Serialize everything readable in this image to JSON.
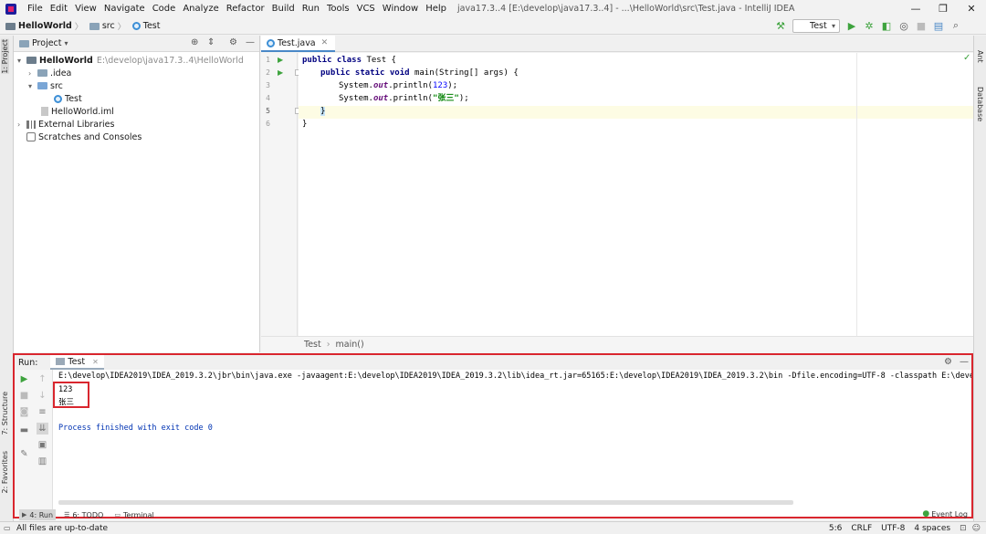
{
  "window": {
    "title": "java17.3..4 [E:\\develop\\java17.3..4] - ...\\HelloWorld\\src\\Test.java - IntelliJ IDEA",
    "minimize": "—",
    "restore": "❐",
    "close": "✕"
  },
  "menu": [
    "File",
    "Edit",
    "View",
    "Navigate",
    "Code",
    "Analyze",
    "Refactor",
    "Build",
    "Run",
    "Tools",
    "VCS",
    "Window",
    "Help"
  ],
  "breadcrumb": {
    "project": "HelloWorld",
    "folder": "src",
    "file": "Test"
  },
  "toolbar": {
    "run_config": "Test"
  },
  "left_strip": {
    "project_tab": "1: Project",
    "structure_tab": "7: Structure",
    "favorites_tab": "2: Favorites"
  },
  "right_strip": {
    "ant_tab": "Ant",
    "database_tab": "Database"
  },
  "project_panel": {
    "title": "Project",
    "tree": {
      "root_name": "HelloWorld",
      "root_path": "E:\\develop\\java17.3..4\\HelloWorld",
      "idea": ".idea",
      "src": "src",
      "test": "Test",
      "iml": "HelloWorld.iml",
      "libraries": "External Libraries",
      "scratches": "Scratches and Consoles"
    }
  },
  "editor": {
    "tab_label": "Test.java",
    "line_numbers": [
      "1",
      "2",
      "3",
      "4",
      "5",
      "6"
    ],
    "code": {
      "l1_kw": "public class",
      "l1_rest": " Test {",
      "l2_kw": "public static void",
      "l2_rest": " main(String[] args) {",
      "l3_a": "System.",
      "l3_field": "out",
      "l3_b": ".println(",
      "l3_num": "123",
      "l3_c": ");",
      "l4_a": "System.",
      "l4_field": "out",
      "l4_b": ".println(",
      "l4_str": "\"张三\"",
      "l4_c": ");",
      "l5": "}",
      "l6": "}"
    },
    "context_breadcrumb": {
      "class": "Test",
      "method": "main()"
    }
  },
  "run_panel": {
    "title": "Run:",
    "tab": "Test",
    "console": {
      "command": "E:\\develop\\IDEA2019\\IDEA_2019.3.2\\jbr\\bin\\java.exe -javaagent:E:\\develop\\IDEA2019\\IDEA_2019.3.2\\lib\\idea_rt.jar=65165:E:\\develop\\IDEA2019\\IDEA_2019.3.2\\bin -Dfile.encoding=UTF-8 -classpath E:\\develo",
      "output1": "123",
      "output2": "张三",
      "exit": "Process finished with exit code 0"
    }
  },
  "bottom_tools": {
    "run": "4: Run",
    "todo": "6: TODO",
    "terminal": "Terminal",
    "event_log": "Event Log"
  },
  "status": {
    "message": "All files are up-to-date",
    "position": "5:6",
    "line_sep": "CRLF",
    "encoding": "UTF-8",
    "indent": "4 spaces"
  },
  "colors": {
    "highlight_border": "#d9262e",
    "run_green": "#3ea33e",
    "keyword": "#000080",
    "string": "#008000"
  }
}
